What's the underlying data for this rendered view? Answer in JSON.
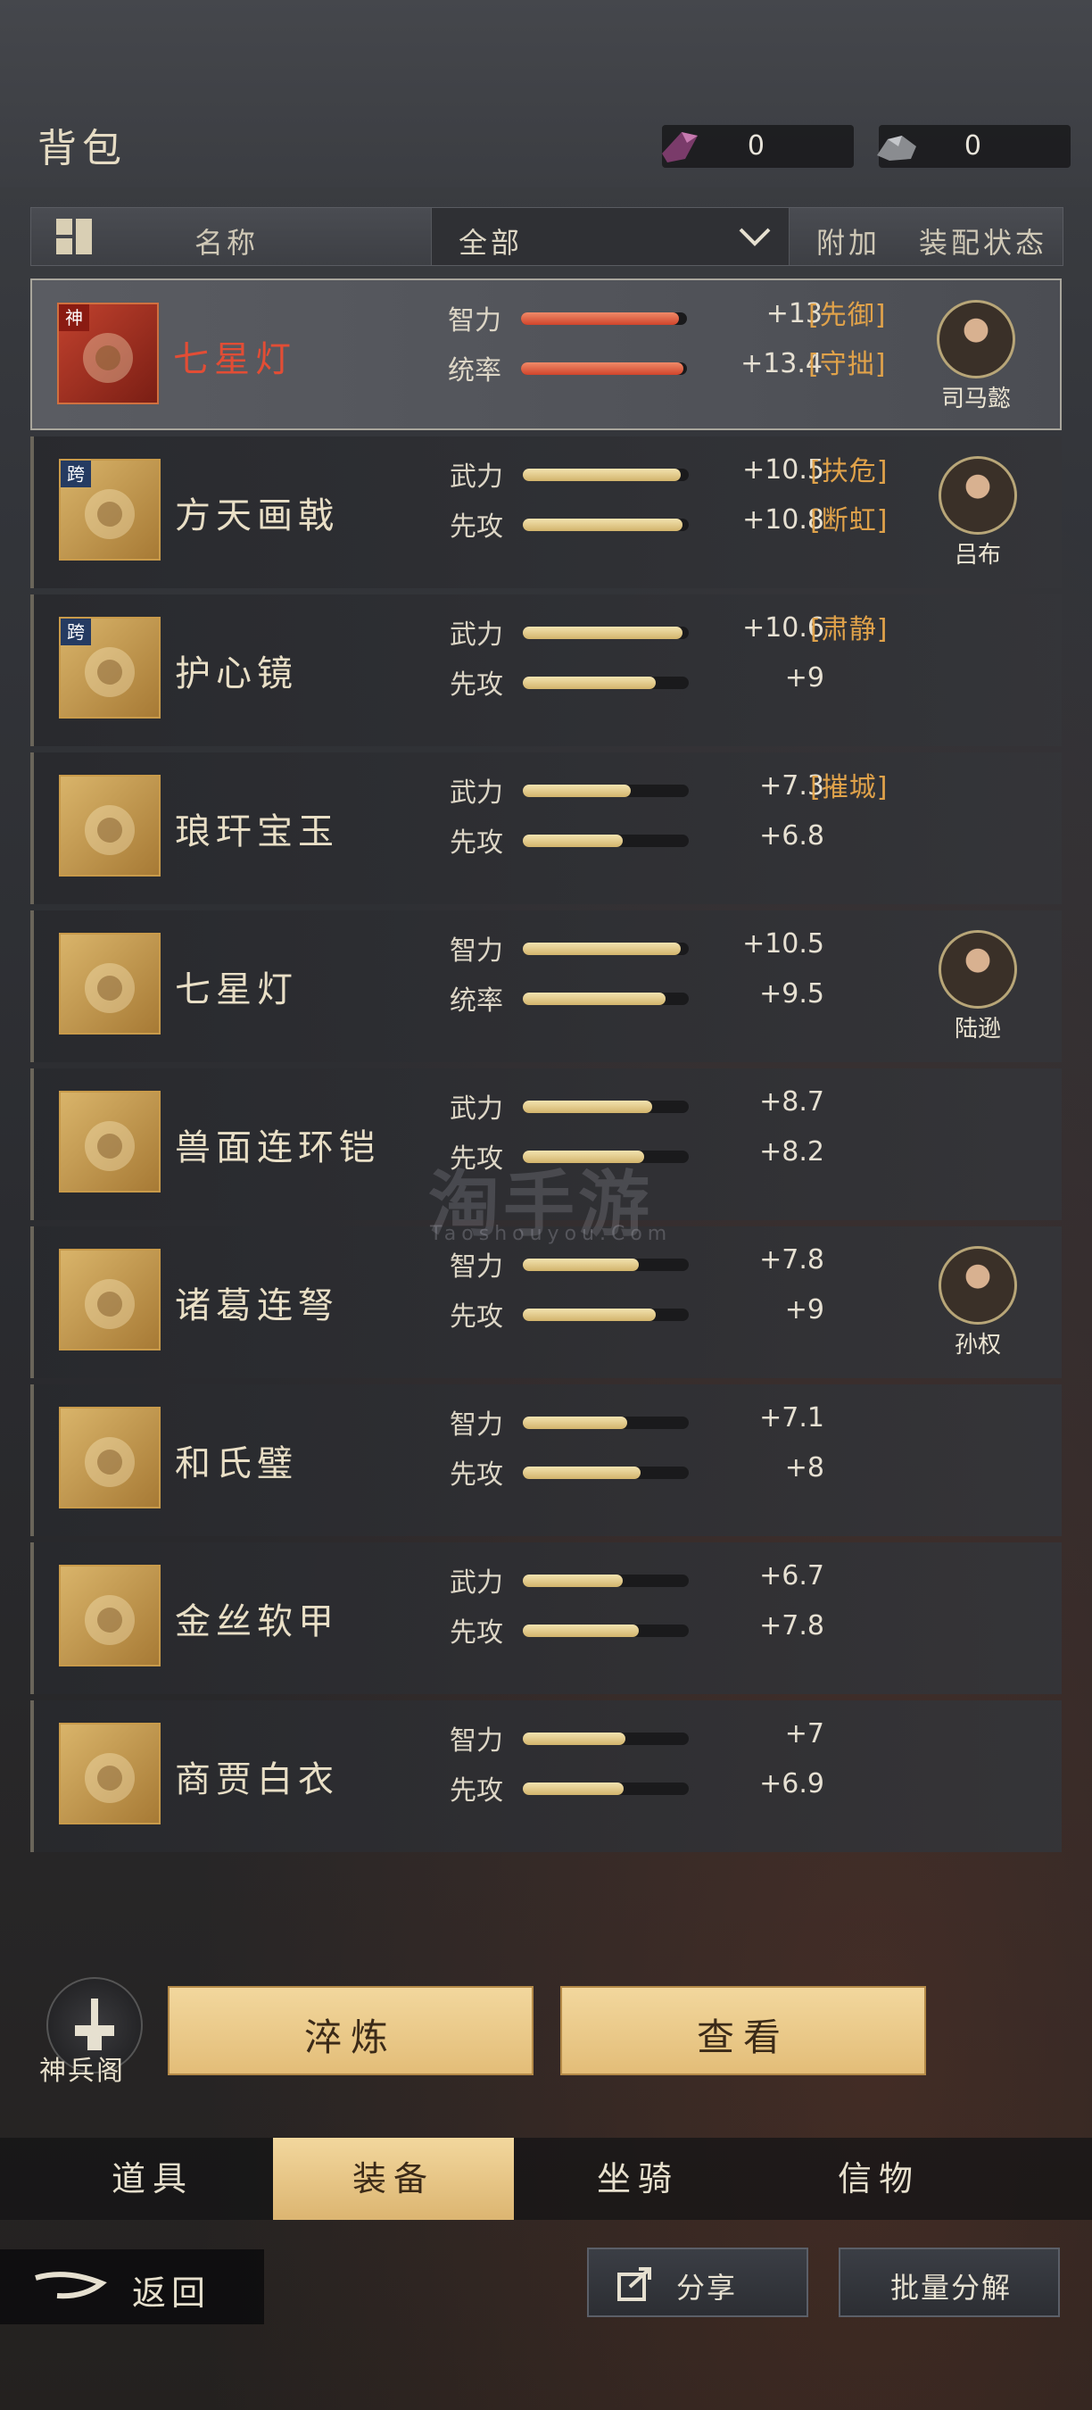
{
  "topbar": {
    "title": "背包",
    "currency1": "0",
    "currency2": "0"
  },
  "header": {
    "name": "名称",
    "filter": "全部",
    "addon": "附加",
    "equip_status": "装配状态"
  },
  "items": [
    {
      "name": "七星灯",
      "tier": "神",
      "tier_type": "god",
      "name_color": "red",
      "selected": true,
      "stats": [
        {
          "label": "智力",
          "value": "+13",
          "fill": 0.95,
          "red": true
        },
        {
          "label": "统率",
          "value": "+13.4",
          "fill": 0.98,
          "red": true
        }
      ],
      "tags": [
        "[先御]",
        "[守拙]"
      ],
      "equipped_by": "司马懿"
    },
    {
      "name": "方天画戟",
      "tier": "跨",
      "tier_type": "cross",
      "stats": [
        {
          "label": "武力",
          "value": "+10.5",
          "fill": 0.95
        },
        {
          "label": "先攻",
          "value": "+10.8",
          "fill": 0.96
        }
      ],
      "tags": [
        "[扶危]",
        "[断虹]"
      ],
      "equipped_by": "吕布"
    },
    {
      "name": "护心镜",
      "tier": "跨",
      "tier_type": "cross",
      "stats": [
        {
          "label": "武力",
          "value": "+10.6",
          "fill": 0.96
        },
        {
          "label": "先攻",
          "value": "+9",
          "fill": 0.8
        }
      ],
      "tags": [
        "[肃静]"
      ],
      "equipped_by": ""
    },
    {
      "name": "琅玕宝玉",
      "stats": [
        {
          "label": "武力",
          "value": "+7.3",
          "fill": 0.65
        },
        {
          "label": "先攻",
          "value": "+6.8",
          "fill": 0.6
        }
      ],
      "tags": [
        "[摧城]"
      ],
      "equipped_by": ""
    },
    {
      "name": "七星灯",
      "stats": [
        {
          "label": "智力",
          "value": "+10.5",
          "fill": 0.95
        },
        {
          "label": "统率",
          "value": "+9.5",
          "fill": 0.86
        }
      ],
      "tags": [],
      "equipped_by": "陆逊"
    },
    {
      "name": "兽面连环铠",
      "stats": [
        {
          "label": "武力",
          "value": "+8.7",
          "fill": 0.78
        },
        {
          "label": "先攻",
          "value": "+8.2",
          "fill": 0.73
        }
      ],
      "tags": [],
      "equipped_by": ""
    },
    {
      "name": "诸葛连弩",
      "stats": [
        {
          "label": "智力",
          "value": "+7.8",
          "fill": 0.7
        },
        {
          "label": "先攻",
          "value": "+9",
          "fill": 0.8
        }
      ],
      "tags": [],
      "equipped_by": "孙权"
    },
    {
      "name": "和氏璧",
      "stats": [
        {
          "label": "智力",
          "value": "+7.1",
          "fill": 0.63
        },
        {
          "label": "先攻",
          "value": "+8",
          "fill": 0.71
        }
      ],
      "tags": [],
      "equipped_by": ""
    },
    {
      "name": "金丝软甲",
      "stats": [
        {
          "label": "武力",
          "value": "+6.7",
          "fill": 0.6
        },
        {
          "label": "先攻",
          "value": "+7.8",
          "fill": 0.7
        }
      ],
      "tags": [],
      "equipped_by": ""
    },
    {
      "name": "商贾白衣",
      "stats": [
        {
          "label": "智力",
          "value": "+7",
          "fill": 0.62
        },
        {
          "label": "先攻",
          "value": "+6.9",
          "fill": 0.61
        }
      ],
      "tags": [],
      "equipped_by": ""
    }
  ],
  "watermark": {
    "main": "淘手游",
    "sub": "Taoshouyou.Com"
  },
  "actions": {
    "smith": "神兵阁",
    "refine": "淬炼",
    "view": "查看"
  },
  "tabs": [
    "道具",
    "装备",
    "坐骑",
    "信物"
  ],
  "active_tab": 1,
  "footer": {
    "back": "返回",
    "share": "分享",
    "batch": "批量分解"
  },
  "colors": {
    "accent_gold": "#e3bd78",
    "red_text": "#e24d35",
    "tag_orange": "#e0a24a"
  }
}
